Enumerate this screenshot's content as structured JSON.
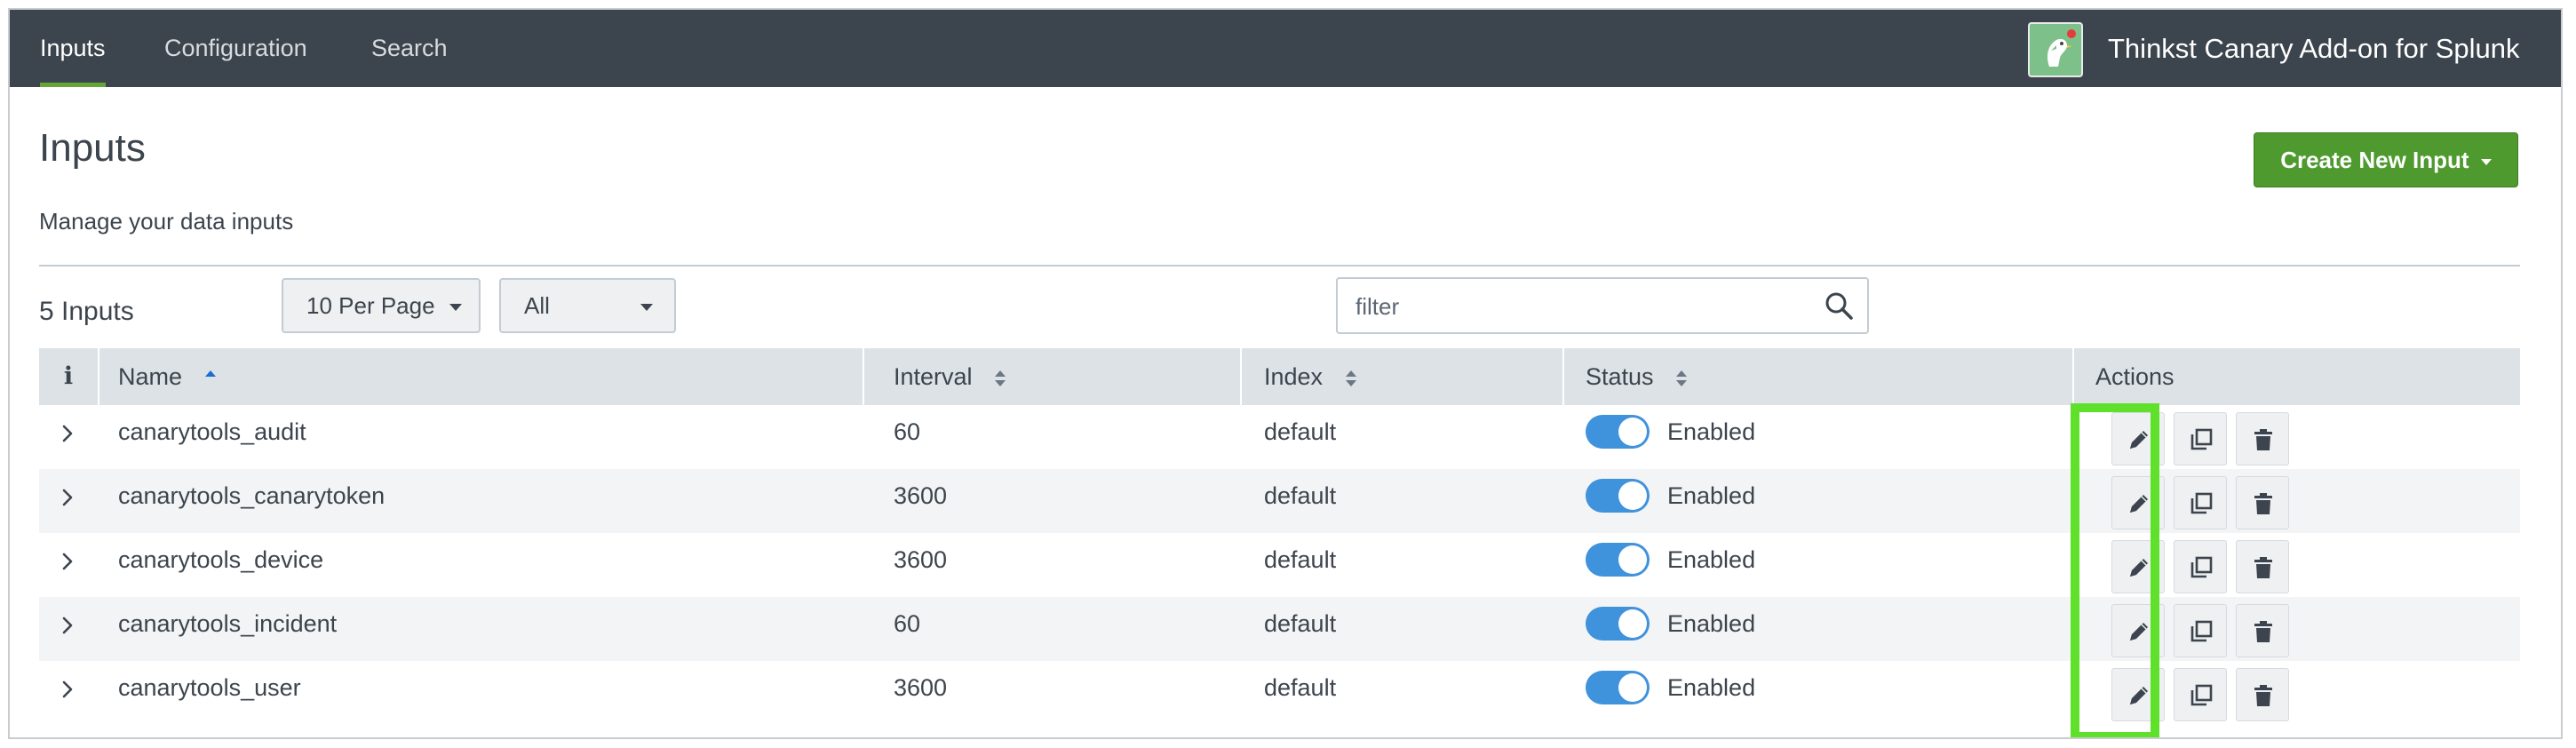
{
  "nav": {
    "tabs": [
      {
        "label": "Inputs",
        "active": true
      },
      {
        "label": "Configuration",
        "active": false
      },
      {
        "label": "Search",
        "active": false
      }
    ],
    "app_title": "Thinkst Canary Add-on for Splunk"
  },
  "header": {
    "title": "Inputs",
    "subtitle": "Manage your data inputs",
    "create_button": "Create New Input"
  },
  "toolbar": {
    "count_label": "5 Inputs",
    "per_page": "10 Per Page",
    "type_filter": "All",
    "filter_placeholder": "filter"
  },
  "table": {
    "columns": {
      "info": "i",
      "name": "Name",
      "interval": "Interval",
      "index": "Index",
      "status": "Status",
      "actions": "Actions"
    },
    "rows": [
      {
        "name": "canarytools_audit",
        "interval": "60",
        "index": "default",
        "status": "Enabled",
        "enabled": true
      },
      {
        "name": "canarytools_canarytoken",
        "interval": "3600",
        "index": "default",
        "status": "Enabled",
        "enabled": true
      },
      {
        "name": "canarytools_device",
        "interval": "3600",
        "index": "default",
        "status": "Enabled",
        "enabled": true
      },
      {
        "name": "canarytools_incident",
        "interval": "60",
        "index": "default",
        "status": "Enabled",
        "enabled": true
      },
      {
        "name": "canarytools_user",
        "interval": "3600",
        "index": "default",
        "status": "Enabled",
        "enabled": true
      }
    ]
  },
  "icons": {
    "expand": "chevron-right-icon",
    "edit": "pencil-icon",
    "clone": "clone-icon",
    "delete": "trash-icon",
    "search": "search-icon"
  },
  "colors": {
    "nav_bg": "#3c444d",
    "active_tab": "#65a637",
    "primary_button": "#4e9a2f",
    "toggle_on": "#3f92dc",
    "highlight": "#5fe02b"
  }
}
